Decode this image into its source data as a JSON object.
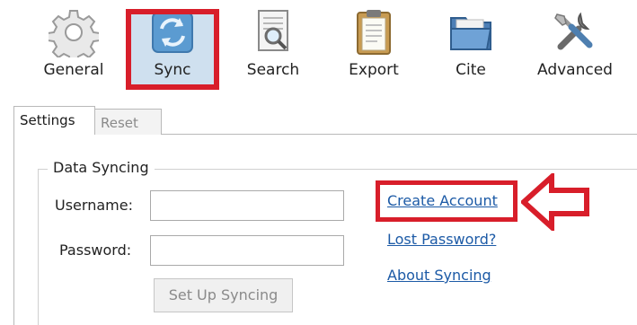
{
  "toolbar": {
    "items": [
      {
        "label": "General",
        "icon": "gear-icon"
      },
      {
        "label": "Sync",
        "icon": "sync-icon"
      },
      {
        "label": "Search",
        "icon": "search-document-icon"
      },
      {
        "label": "Export",
        "icon": "clipboard-icon"
      },
      {
        "label": "Cite",
        "icon": "folder-icon"
      },
      {
        "label": "Advanced",
        "icon": "tools-icon"
      }
    ],
    "selected": "Sync"
  },
  "tabs": [
    {
      "label": "Settings",
      "active": true
    },
    {
      "label": "Reset",
      "active": false
    }
  ],
  "data_syncing": {
    "title": "Data Syncing",
    "username_label": "Username:",
    "username_value": "",
    "password_label": "Password:",
    "password_value": "",
    "setup_button": "Set Up Syncing"
  },
  "links": {
    "create_account": "Create Account",
    "lost_password": "Lost Password?",
    "about_syncing": "About Syncing"
  },
  "colors": {
    "highlight_red": "#d81e2a",
    "link_blue": "#1c5aa6",
    "selected_bg": "#cfe0ef"
  }
}
